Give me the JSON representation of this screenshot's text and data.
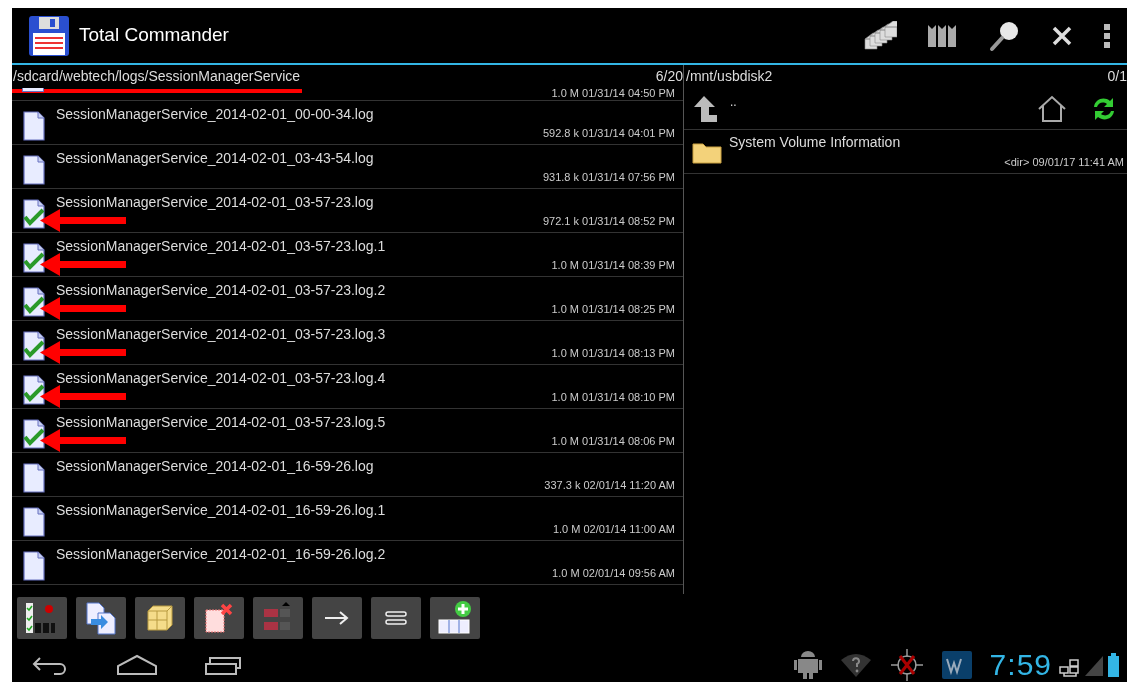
{
  "app_bar": {
    "title": "Total Commander"
  },
  "left_panel": {
    "path": "/sdcard/webtech/logs/SessionManagerService",
    "path_underlined": true,
    "count": "6/20",
    "partial_row": {
      "meta": "1.0 M 01/31/14 04:50 PM"
    },
    "rows": [
      {
        "name": "SessionManagerService_2014-02-01_00-00-34.log",
        "meta": "592.8 k 01/31/14 04:01 PM",
        "checked": false,
        "arrow": false
      },
      {
        "name": "SessionManagerService_2014-02-01_03-43-54.log",
        "meta": "931.8 k 01/31/14 07:56 PM",
        "checked": false,
        "arrow": false
      },
      {
        "name": "SessionManagerService_2014-02-01_03-57-23.log",
        "meta": "972.1 k 01/31/14 08:52 PM",
        "checked": true,
        "arrow": true
      },
      {
        "name": "SessionManagerService_2014-02-01_03-57-23.log.1",
        "meta": "1.0 M 01/31/14 08:39 PM",
        "checked": true,
        "arrow": true
      },
      {
        "name": "SessionManagerService_2014-02-01_03-57-23.log.2",
        "meta": "1.0 M 01/31/14 08:25 PM",
        "checked": true,
        "arrow": true
      },
      {
        "name": "SessionManagerService_2014-02-01_03-57-23.log.3",
        "meta": "1.0 M 01/31/14 08:13 PM",
        "checked": true,
        "arrow": true
      },
      {
        "name": "SessionManagerService_2014-02-01_03-57-23.log.4",
        "meta": "1.0 M 01/31/14 08:10 PM",
        "checked": true,
        "arrow": true
      },
      {
        "name": "SessionManagerService_2014-02-01_03-57-23.log.5",
        "meta": "1.0 M 01/31/14 08:06 PM",
        "checked": true,
        "arrow": true
      },
      {
        "name": "SessionManagerService_2014-02-01_16-59-26.log",
        "meta": "337.3 k 02/01/14 11:20 AM",
        "checked": false,
        "arrow": false
      },
      {
        "name": "SessionManagerService_2014-02-01_16-59-26.log.1",
        "meta": "1.0 M 02/01/14 11:00 AM",
        "checked": false,
        "arrow": false
      },
      {
        "name": "SessionManagerService_2014-02-01_16-59-26.log.2",
        "meta": "1.0 M 02/01/14 09:56 AM",
        "checked": false,
        "arrow": false
      }
    ]
  },
  "right_panel": {
    "path": "/mnt/usbdisk2",
    "count": "0/1",
    "up_label": "..",
    "rows": [
      {
        "name": "System Volume Information",
        "meta": "<dir> 09/01/17 11:41 AM"
      }
    ]
  },
  "status_bar": {
    "time": "7:59"
  }
}
